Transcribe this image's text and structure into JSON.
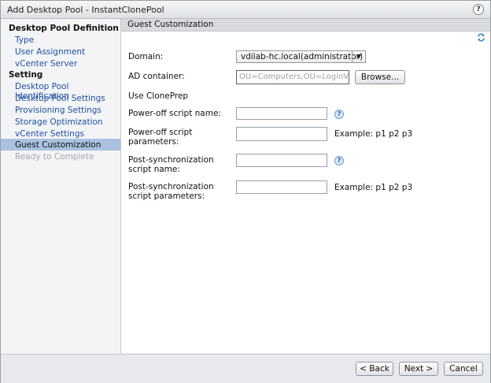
{
  "window": {
    "title": "Add Desktop Pool - InstantClonePool",
    "help_glyph": "?"
  },
  "sidebar": {
    "sections": [
      {
        "label": "Desktop Pool Definition"
      },
      {
        "label": "Setting"
      }
    ],
    "items": [
      {
        "label": "Type"
      },
      {
        "label": "User Assignment"
      },
      {
        "label": "vCenter Server"
      },
      {
        "label": "Desktop Pool Identification"
      },
      {
        "label": "Desktop Pool Settings"
      },
      {
        "label": "Provisioning Settings"
      },
      {
        "label": "Storage Optimization"
      },
      {
        "label": "vCenter Settings"
      },
      {
        "label": "Guest Customization"
      },
      {
        "label": "Ready to Complete"
      }
    ]
  },
  "panel": {
    "title": "Guest Customization",
    "domain": {
      "label": "Domain:",
      "value": "vdilab-hc.local(administrator)",
      "dropdown_glyph": "▼"
    },
    "ad_container": {
      "label": "AD container:",
      "value": "OU=Computers,OU=LoginVSI",
      "browse": "Browse..."
    },
    "use_cloneprep": "Use ClonePrep",
    "fields": [
      {
        "label": "Power-off script name:",
        "example": ""
      },
      {
        "label": "Power-off script parameters:",
        "example": "Example: p1 p2 p3"
      },
      {
        "label": "Post-synchronization script name:",
        "example": ""
      },
      {
        "label": "Post-synchronization script parameters:",
        "example": "Example: p1 p2 p3"
      }
    ],
    "info_glyph": "?"
  },
  "footer": {
    "back": "< Back",
    "next": "Next >",
    "cancel": "Cancel"
  }
}
